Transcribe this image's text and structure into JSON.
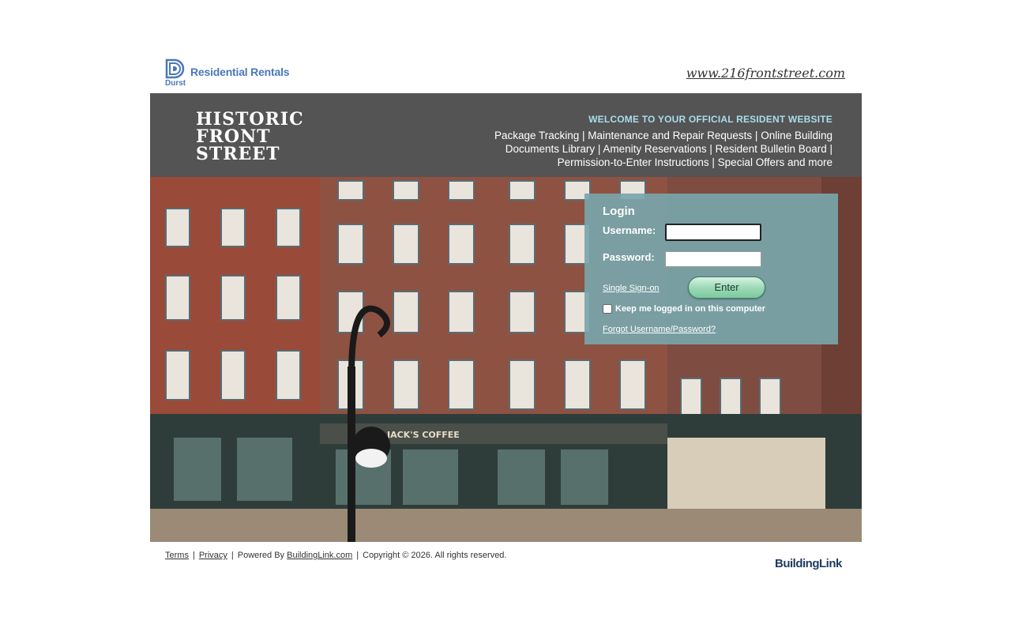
{
  "header": {
    "brand_durst": "Durst",
    "brand_text": "Residential Rentals",
    "site_url": "www.216frontstreet.com"
  },
  "banner": {
    "logo_lines": [
      "HISTORIC",
      "FRONT",
      "STREET"
    ],
    "welcome": "WELCOME TO YOUR OFFICIAL RESIDENT WEBSITE",
    "features_line1": "Package Tracking | Maintenance and Repair Requests | Online Building",
    "features_line2": "Documents Library | Amenity Reservations | Resident Bulletin Board |",
    "features_line3": "Permission-to-Enter Instructions | Special Offers and more"
  },
  "hero": {
    "store_signs": [
      "JACK'S COFFEE"
    ]
  },
  "login": {
    "title": "Login",
    "username_label": "Username:",
    "username_value": "",
    "password_label": "Password:",
    "password_value": "",
    "sso_label": "Single Sign-on",
    "enter_label": "Enter",
    "keep_logged_in_label": "Keep me logged in on this computer",
    "keep_logged_in_checked": false,
    "forgot_label": "Forgot Username/Password?"
  },
  "footer": {
    "terms": "Terms",
    "privacy": "Privacy",
    "powered_by": "Powered By",
    "buildinglink": "BuildingLink.com",
    "copyright": "Copyright © 2026. All rights reserved.",
    "bl_logo": "BuildingLink"
  },
  "colors": {
    "banner_bg": "#545454",
    "welcome_accent": "#a8ddea",
    "login_panel": "#78a5aa",
    "brand_blue": "#4a78b8",
    "enter_button": "#9ddab7"
  }
}
